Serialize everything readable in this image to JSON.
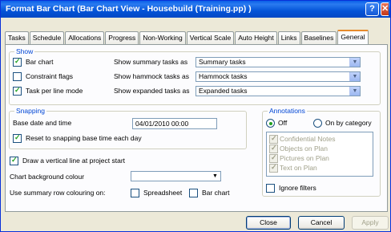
{
  "window": {
    "title": "Format Bar Chart (Bar Chart View - Housebuild (Training.pp) )"
  },
  "tabs": [
    "Tasks",
    "Schedule",
    "Allocations",
    "Progress",
    "Non-Working",
    "Vertical Scale",
    "Auto Height",
    "Links",
    "Baselines",
    "General"
  ],
  "show": {
    "title": "Show",
    "bar_chart": "Bar chart",
    "constraint_flags": "Constraint flags",
    "task_per_line": "Task per line mode",
    "summary_label": "Show summary tasks as",
    "summary_value": "Summary tasks",
    "hammock_label": "Show hammock tasks as",
    "hammock_value": "Hammock tasks",
    "expanded_label": "Show expanded tasks as",
    "expanded_value": "Expanded tasks"
  },
  "snapping": {
    "title": "Snapping",
    "base_label": "Base date and time",
    "base_value": "04/01/2010 00:00",
    "reset_label": "Reset to snapping base time each day"
  },
  "misc": {
    "vertical_line": "Draw a vertical line at project start",
    "bg_label": "Chart background colour",
    "summary_row_label": "Use summary row colouring on:",
    "spreadsheet": "Spreadsheet",
    "bar_chart": "Bar chart"
  },
  "annotations": {
    "title": "Annotations",
    "off": "Off",
    "by_category": "On by category",
    "items": [
      "Confidential Notes",
      "Objects on Plan",
      "Pictures on Plan",
      "Text on Plan"
    ],
    "ignore_filters": "Ignore filters"
  },
  "buttons": {
    "close": "Close",
    "cancel": "Cancel",
    "apply": "Apply"
  }
}
